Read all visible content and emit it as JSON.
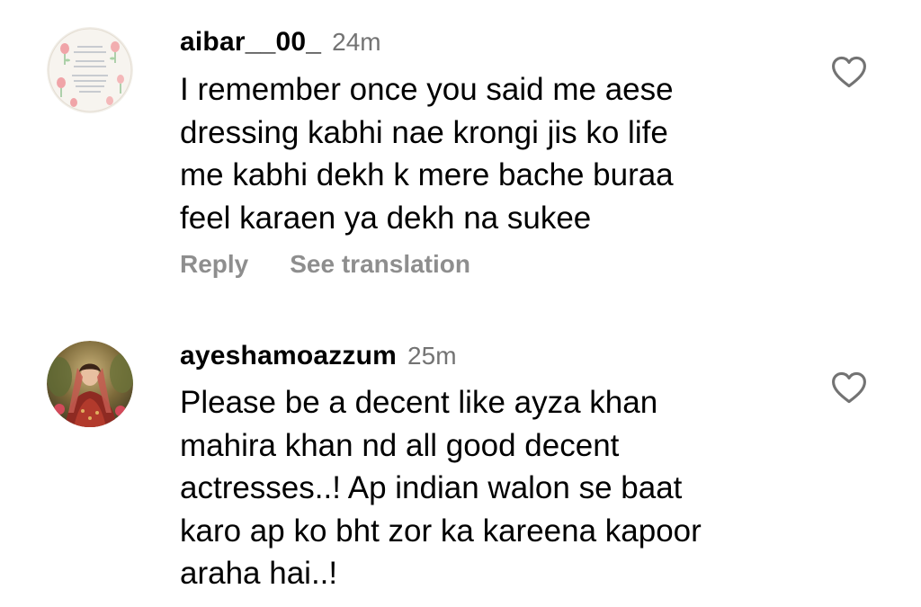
{
  "comments": [
    {
      "username": "aibar__00_",
      "time": "24m",
      "text": "I remember once you said me aese\ndressing kabhi nae krongi jis ko life\nme kabhi dekh k mere bache buraa\nfeel karaen ya dekh na sukee",
      "reply_label": "Reply",
      "translate_label": "See translation",
      "like_icon": "heart-outline-icon",
      "avatar_icon": "floral-text-avatar"
    },
    {
      "username": "ayeshamoazzum",
      "time": "25m",
      "text": "Please be a decent like ayza khan\nmahira khan nd all good decent\nactresses..! Ap indian walon se baat\nkaro ap ko bht zor ka kareena kapoor\naraha hai..!",
      "like_icon": "heart-outline-icon",
      "avatar_icon": "profile-photo-avatar"
    }
  ],
  "colors": {
    "text": "#000000",
    "muted": "#737373",
    "action": "#8e8e8e"
  }
}
